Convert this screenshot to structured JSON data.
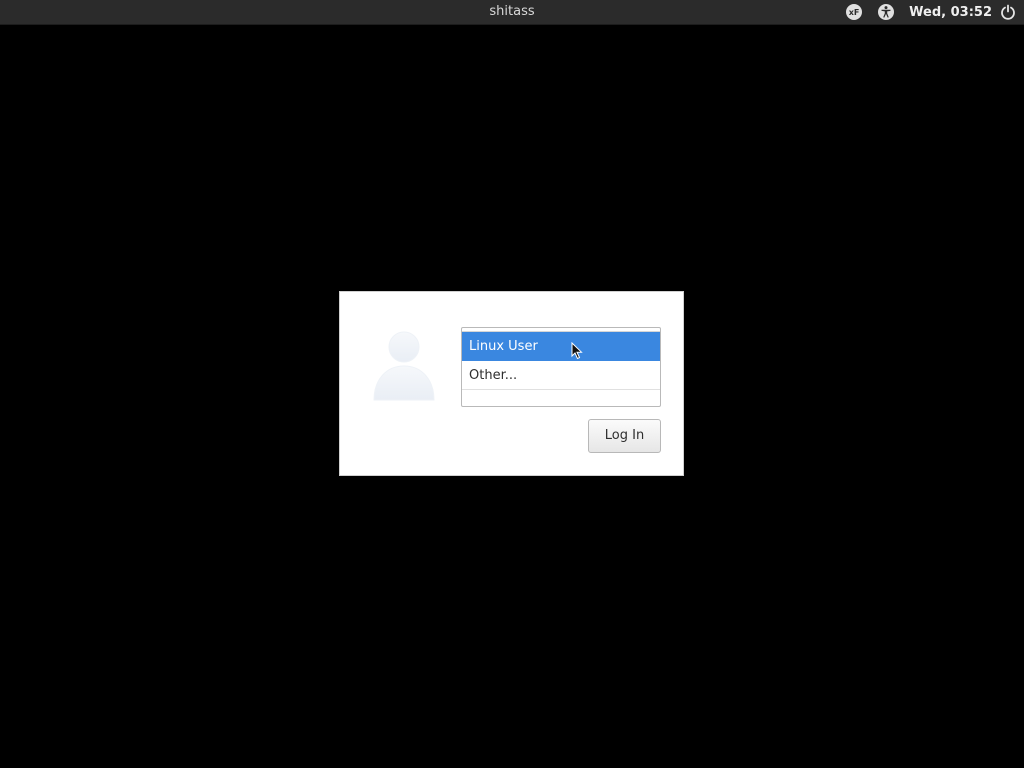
{
  "top_bar": {
    "hostname": "shitass",
    "clock": "Wed, 03:52",
    "icons": [
      "keyboard-layout-icon",
      "accessibility-icon",
      "power-icon"
    ],
    "keyboard_layout_label": "xF"
  },
  "login": {
    "users": [
      {
        "label": "Linux User",
        "selected": true
      },
      {
        "label": "Other...",
        "selected": false
      }
    ],
    "login_button_label": "Log In"
  },
  "colors": {
    "selection": "#3a87e0",
    "top_bar_bg": "#2b2b2b",
    "background": "#000000"
  }
}
